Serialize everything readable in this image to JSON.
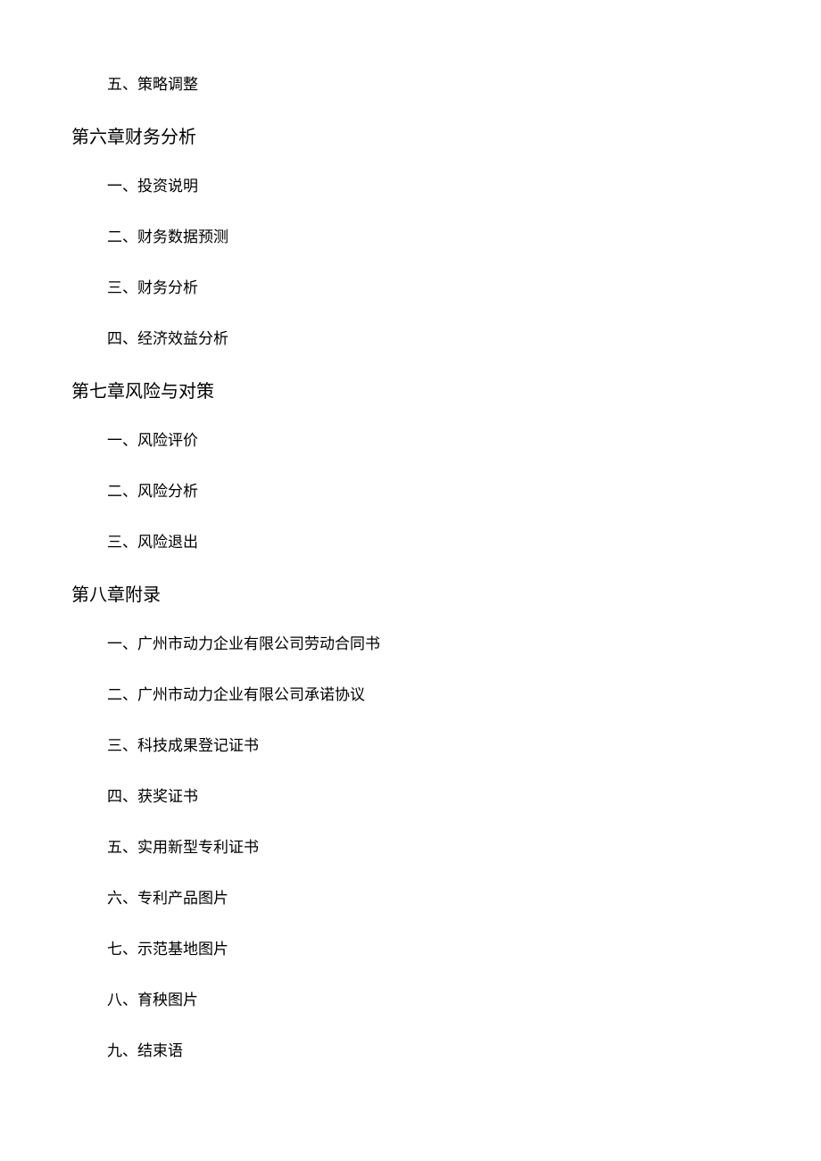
{
  "toc": {
    "pre_items": [
      "五、策略调整"
    ],
    "chapters": [
      {
        "title": "第六章财务分析",
        "items": [
          "一、投资说明",
          "二、财务数据预测",
          "三、财务分析",
          "四、经济效益分析"
        ]
      },
      {
        "title": "第七章风险与对策",
        "items": [
          "一、风险评价",
          "二、风险分析",
          "三、风险退出"
        ]
      },
      {
        "title": "第八章附录",
        "items": [
          "一、广州市动力企业有限公司劳动合同书",
          "二、广州市动力企业有限公司承诺协议",
          "三、科技成果登记证书",
          "四、获奖证书",
          "五、实用新型专利证书",
          "六、专利产品图片",
          "七、示范基地图片",
          "八、育秧图片",
          "九、结束语"
        ]
      }
    ]
  }
}
